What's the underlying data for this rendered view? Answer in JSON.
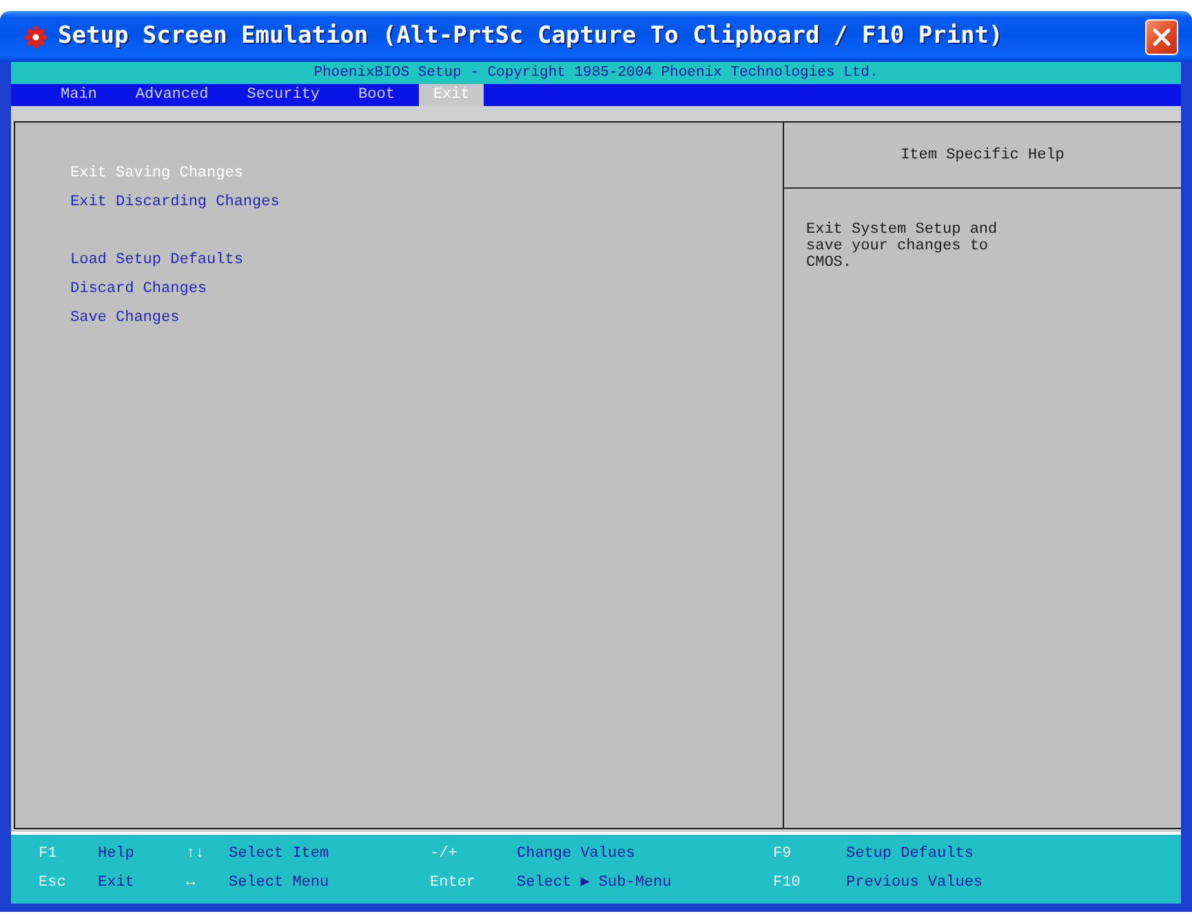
{
  "window": {
    "title": "Setup Screen Emulation (Alt-PrtSc Capture To Clipboard / F10 Print)"
  },
  "banner": "PhoenixBIOS Setup - Copyright 1985-2004 Phoenix Technologies Ltd.",
  "tabs": [
    {
      "label": "Main",
      "selected": false
    },
    {
      "label": "Advanced",
      "selected": false
    },
    {
      "label": "Security",
      "selected": false
    },
    {
      "label": "Boot",
      "selected": false
    },
    {
      "label": "Exit",
      "selected": true
    }
  ],
  "menu": {
    "groups": [
      {
        "items": [
          {
            "label": "Exit Saving Changes",
            "selected": true
          },
          {
            "label": "Exit Discarding Changes",
            "selected": false
          }
        ]
      },
      {
        "items": [
          {
            "label": "Load Setup Defaults",
            "selected": false
          },
          {
            "label": "Discard Changes",
            "selected": false
          },
          {
            "label": "Save Changes",
            "selected": false
          }
        ]
      }
    ]
  },
  "help": {
    "title": "Item Specific Help",
    "text": "Exit System Setup and save your changes to CMOS."
  },
  "legend": {
    "rows": [
      [
        {
          "key": "F1",
          "action": "Help"
        },
        {
          "key": "↑↓",
          "action": "Select Item"
        },
        {
          "key": "-/+",
          "action": "Change Values"
        },
        {
          "key": "F9",
          "action": "Setup Defaults"
        }
      ],
      [
        {
          "key": "Esc",
          "action": "Exit"
        },
        {
          "key": "↔",
          "action": "Select Menu"
        },
        {
          "key": "Enter",
          "action": "Select ▶ Sub-Menu"
        },
        {
          "key": "F10",
          "action": "Previous Values"
        }
      ]
    ]
  }
}
